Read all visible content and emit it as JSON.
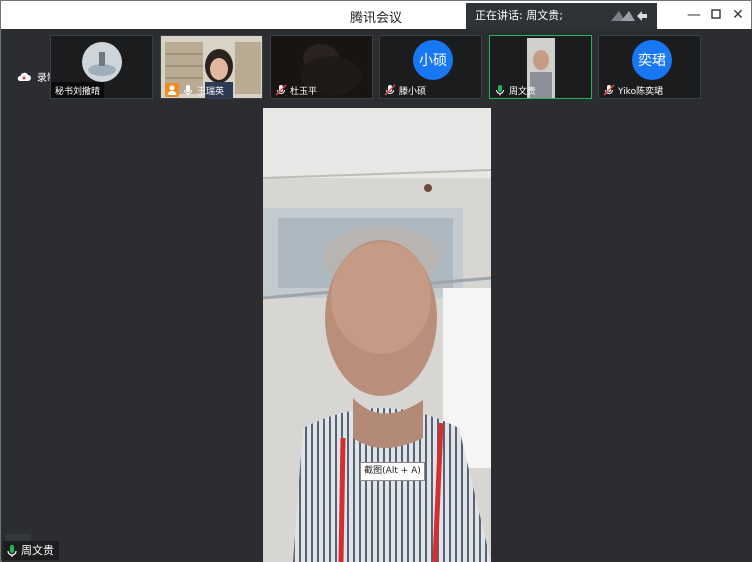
{
  "window": {
    "title": "腾讯会议"
  },
  "speaking": {
    "label": "正在讲话: 周文贵;"
  },
  "recording": {
    "label": "录制中"
  },
  "participants": [
    {
      "name": "秘书刘撒晴",
      "avatar": "",
      "mic": "none"
    },
    {
      "name": "王瑞英",
      "avatar": "",
      "mic": "on"
    },
    {
      "name": "杜玉平",
      "avatar": "",
      "mic": "muted"
    },
    {
      "name": "滕小硕",
      "avatar": "小硕",
      "mic": "muted"
    },
    {
      "name": "周文贵",
      "avatar": "",
      "mic": "on"
    },
    {
      "name": "Yiko陈奕珺",
      "avatar": "奕珺",
      "mic": "muted"
    }
  ],
  "tooltip": {
    "label": "截图(Alt + A)"
  },
  "main_speaker": {
    "name": "周文贵"
  },
  "colors": {
    "accent_blue": "#1877f2",
    "speaking_green": "#25b35a",
    "mute_red": "#e5484d"
  }
}
